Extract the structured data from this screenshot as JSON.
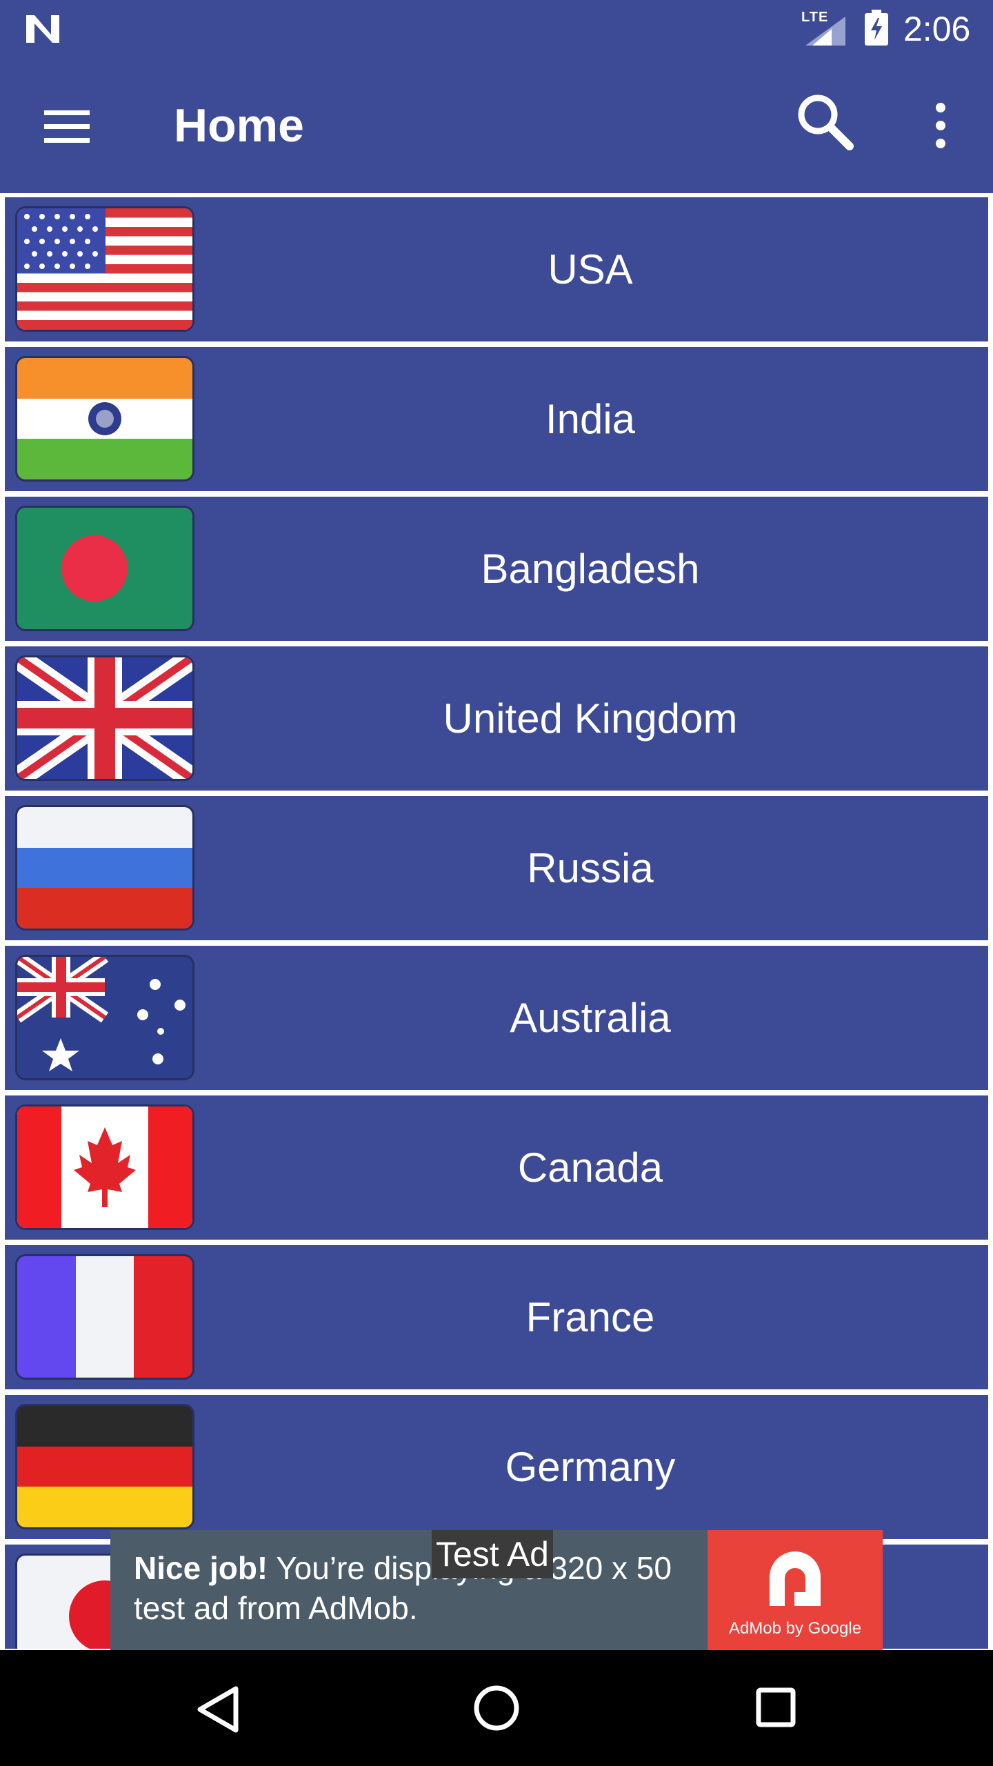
{
  "status_bar": {
    "network": "LTE",
    "time": "2:06"
  },
  "app_bar": {
    "title": "Home",
    "icons": [
      "menu-icon",
      "search-icon",
      "overflow-menu-icon"
    ]
  },
  "countries": [
    {
      "name": "USA",
      "flag": "usa-flag-icon"
    },
    {
      "name": "India",
      "flag": "india-flag-icon"
    },
    {
      "name": "Bangladesh",
      "flag": "bangladesh-flag-icon"
    },
    {
      "name": "United Kingdom",
      "flag": "uk-flag-icon"
    },
    {
      "name": "Russia",
      "flag": "russia-flag-icon"
    },
    {
      "name": "Australia",
      "flag": "australia-flag-icon"
    },
    {
      "name": "Canada",
      "flag": "canada-flag-icon"
    },
    {
      "name": "France",
      "flag": "france-flag-icon"
    },
    {
      "name": "Germany",
      "flag": "germany-flag-icon"
    },
    {
      "name": "",
      "flag": "japan-flag-icon"
    }
  ],
  "ad": {
    "label": "Test Ad",
    "headline": "Nice job!",
    "body": " You’re displaying a 320 x 50 test ad from AdMob.",
    "logo_caption": "AdMob by Google"
  },
  "nav_bar": {
    "buttons": [
      "back-icon",
      "home-icon",
      "recents-icon"
    ]
  },
  "colors": {
    "primary": "#3d4a95",
    "row_background": "#3d4a95",
    "divider": "#ffffff",
    "ad_background": "#4d5c69",
    "admob_red": "#e8423b"
  }
}
